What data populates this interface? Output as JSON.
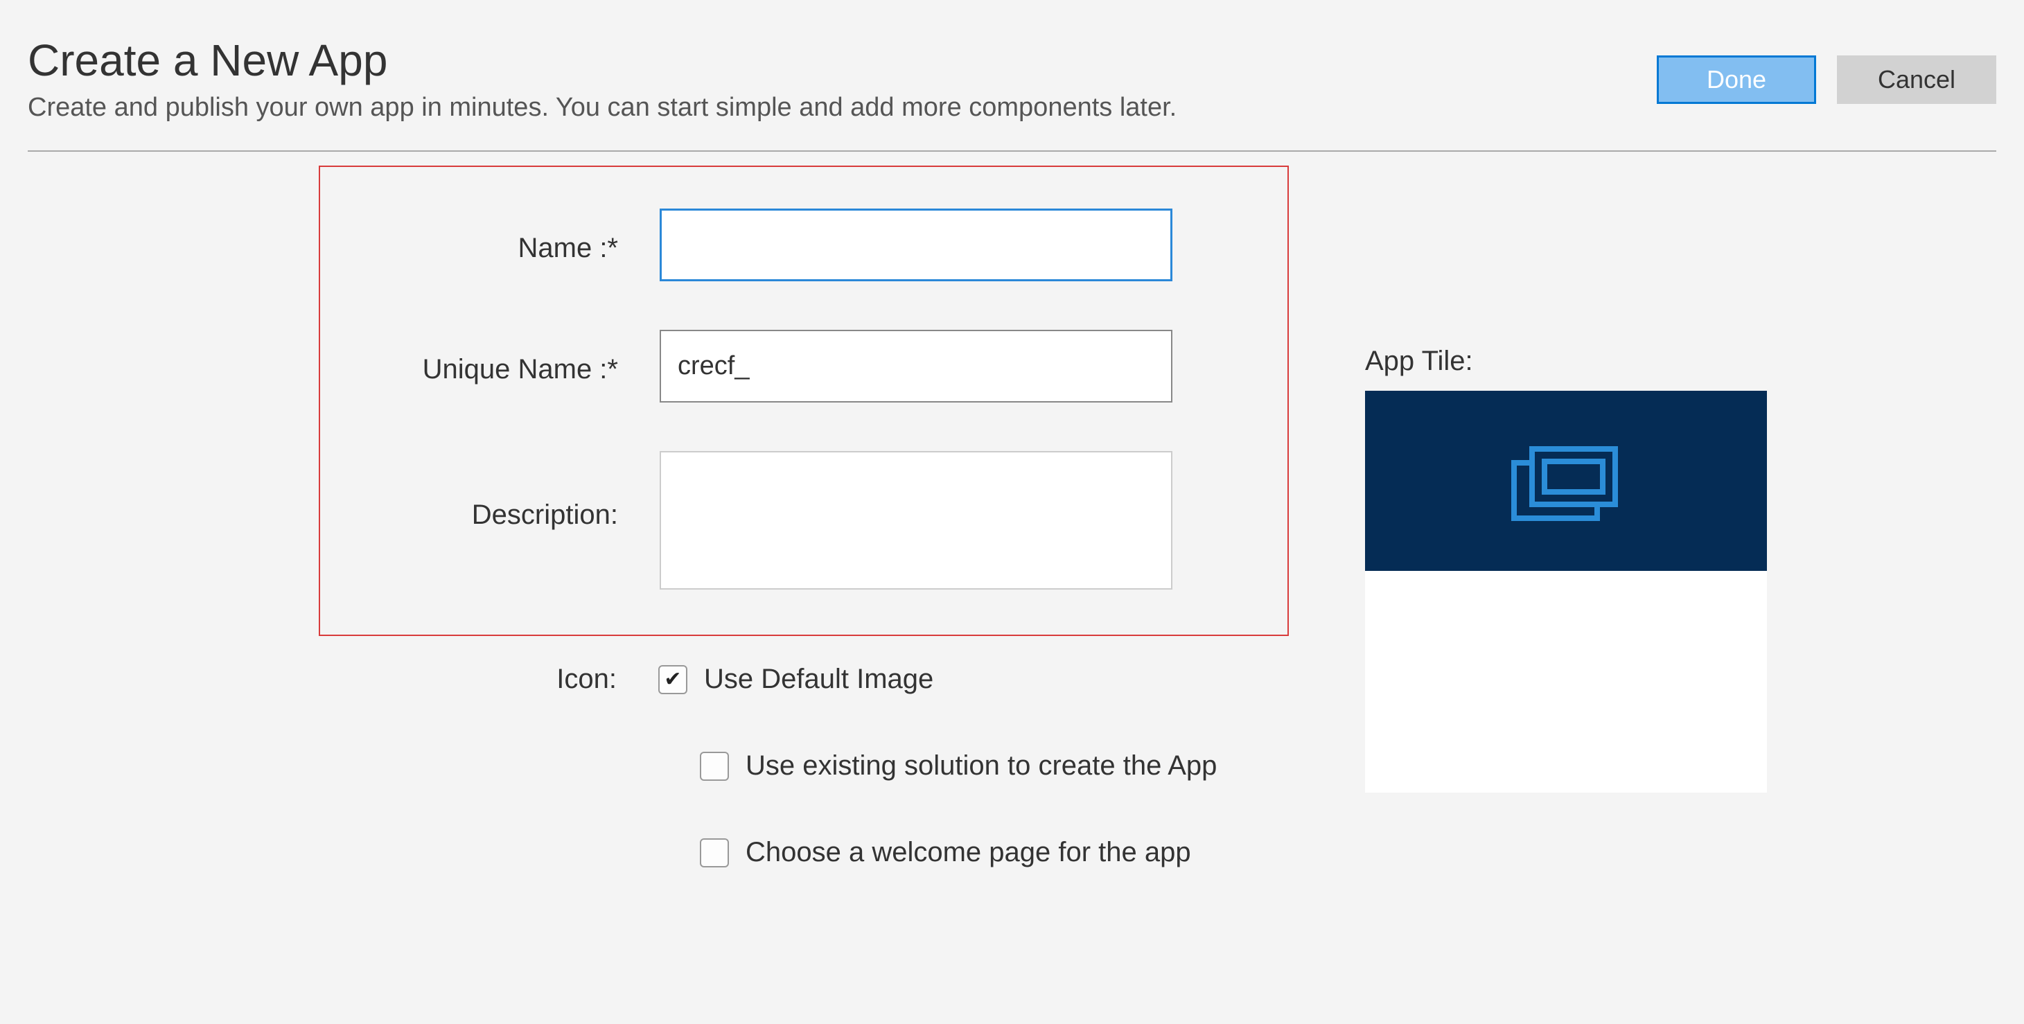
{
  "header": {
    "title": "Create a New App",
    "subtitle": "Create and publish your own app in minutes. You can start simple and add more components later.",
    "done_label": "Done",
    "cancel_label": "Cancel"
  },
  "form": {
    "name_label": "Name :*",
    "name_value": "",
    "unique_name_label": "Unique Name :*",
    "unique_name_value": "crecf_",
    "description_label": "Description:",
    "description_value": "",
    "icon_label": "Icon:",
    "use_default_image_label": "Use Default Image",
    "use_default_image_checked": true,
    "use_existing_solution_label": "Use existing solution to create the App",
    "use_existing_solution_checked": false,
    "choose_welcome_page_label": "Choose a welcome page for the app",
    "choose_welcome_page_checked": false
  },
  "tile": {
    "label": "App Tile:"
  },
  "colors": {
    "tile_bg": "#052c55",
    "tile_icon": "#2b8dd8",
    "accent": "#2b88d8",
    "highlight_border": "#d83b3b"
  }
}
